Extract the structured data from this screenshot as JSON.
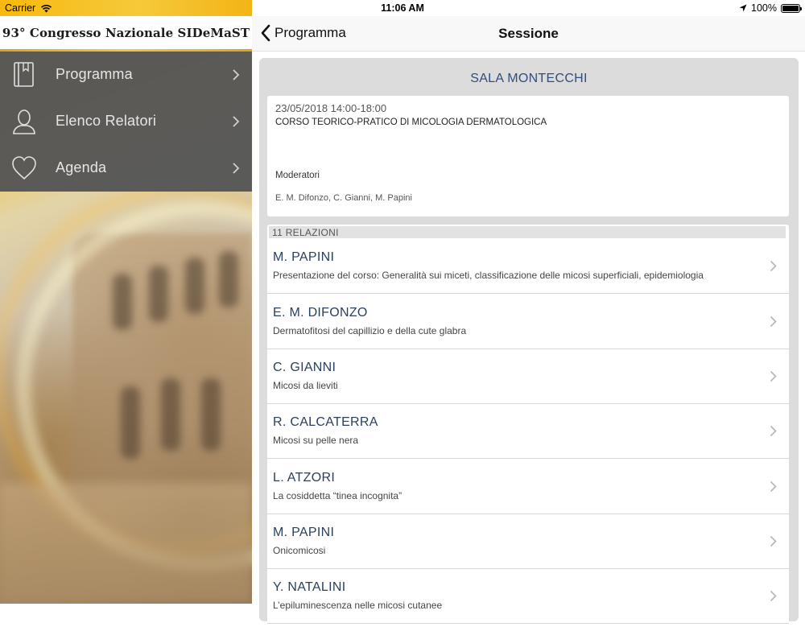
{
  "status_bar": {
    "carrier": "Carrier",
    "time": "11:06 AM",
    "battery": "100%"
  },
  "sidebar": {
    "title": "93° Congresso Nazionale SIDeMaST",
    "items": [
      {
        "label": "Programma",
        "icon": "book-icon"
      },
      {
        "label": "Elenco Relatori",
        "icon": "person-icon"
      },
      {
        "label": "Agenda",
        "icon": "heart-icon"
      }
    ]
  },
  "navbar": {
    "back_label": "Programma",
    "title": "Sessione"
  },
  "session": {
    "room": "SALA MONTECCHI",
    "datetime": "23/05/2018 14:00-18:00",
    "course": "CORSO TEORICO-PRATICO DI MICOLOGIA DERMATOLOGICA",
    "moderators_label": "Moderatori",
    "moderators": "E. M. Difonzo, C. Gianni, M. Papini"
  },
  "relazioni": {
    "header": "11 RELAZIONI",
    "items": [
      {
        "speaker": "M. PAPINI",
        "title": "Presentazione del corso: Generalità sui miceti, classificazione delle micosi superficiali, epidemiologia"
      },
      {
        "speaker": "E. M. DIFONZO",
        "title": "Dermatofitosi del capillizio e della cute glabra"
      },
      {
        "speaker": "C. GIANNI",
        "title": "Micosi da lieviti"
      },
      {
        "speaker": "R. CALCATERRA",
        "title": "Micosi su pelle nera"
      },
      {
        "speaker": "L. ATZORI",
        "title": "La cosiddetta “tinea incognita”"
      },
      {
        "speaker": "M. PAPINI",
        "title": "Onicomicosi"
      },
      {
        "speaker": "Y.  NATALINI",
        "title": "L’epiluminescenza nelle micosi cutanee"
      }
    ]
  },
  "colors": {
    "accent_gold": "#f2c841",
    "menu_bg": "#565656",
    "room_title": "#2f4e7c",
    "speaker_text": "#2a3f5c"
  }
}
